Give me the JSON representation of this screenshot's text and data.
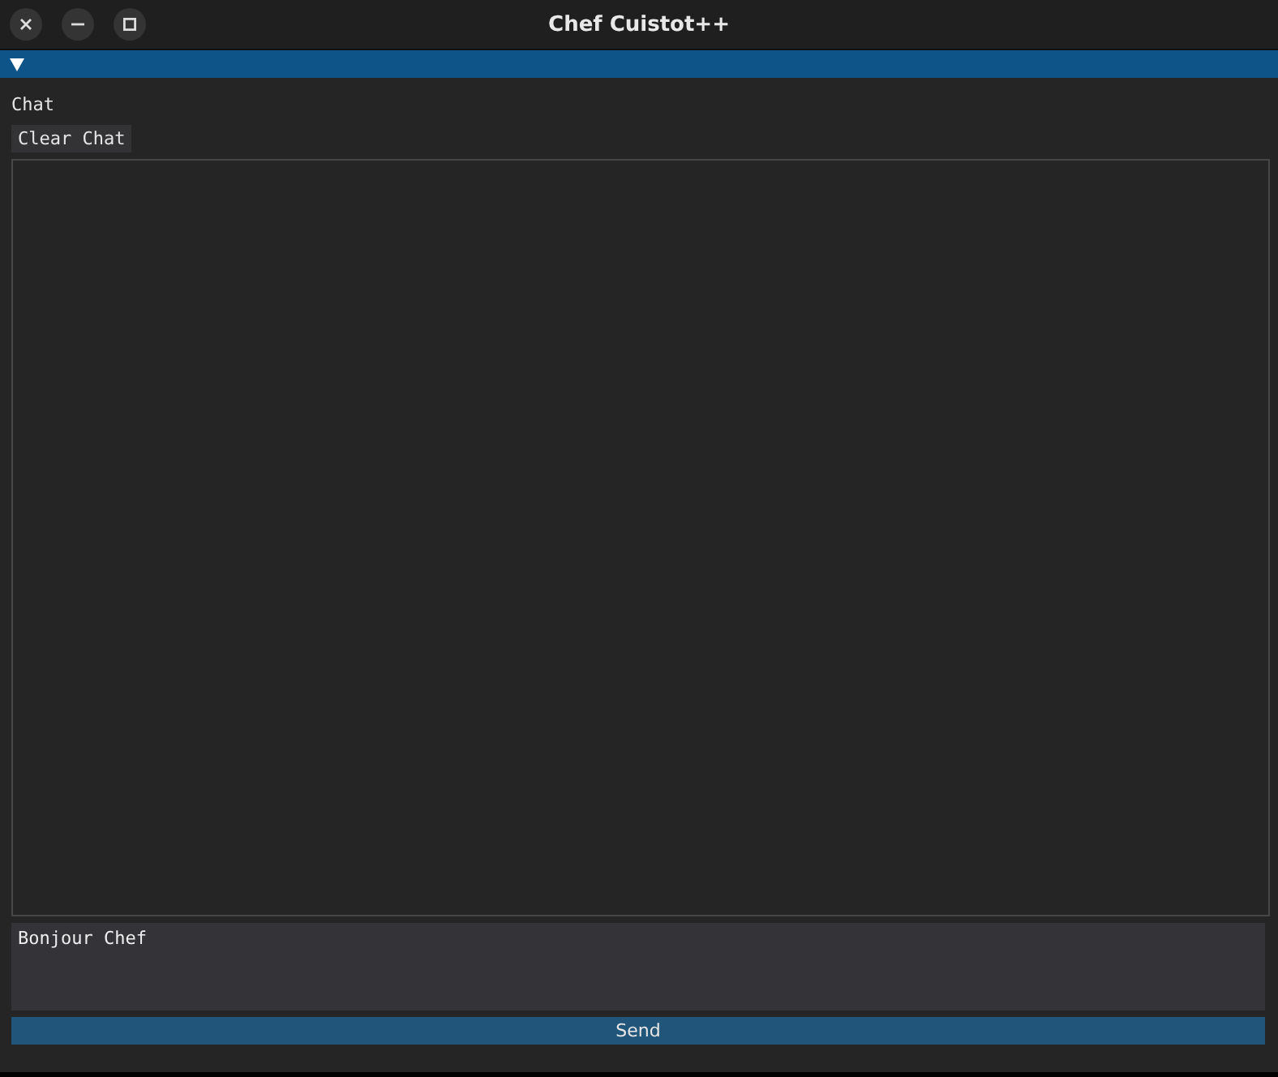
{
  "window": {
    "title": "Chef Cuistot++"
  },
  "panel": {
    "expanded": true,
    "heading": "Chat",
    "clear_button": "Clear Chat"
  },
  "message_input": {
    "value": "Bonjour Chef"
  },
  "send_button": "Send"
}
